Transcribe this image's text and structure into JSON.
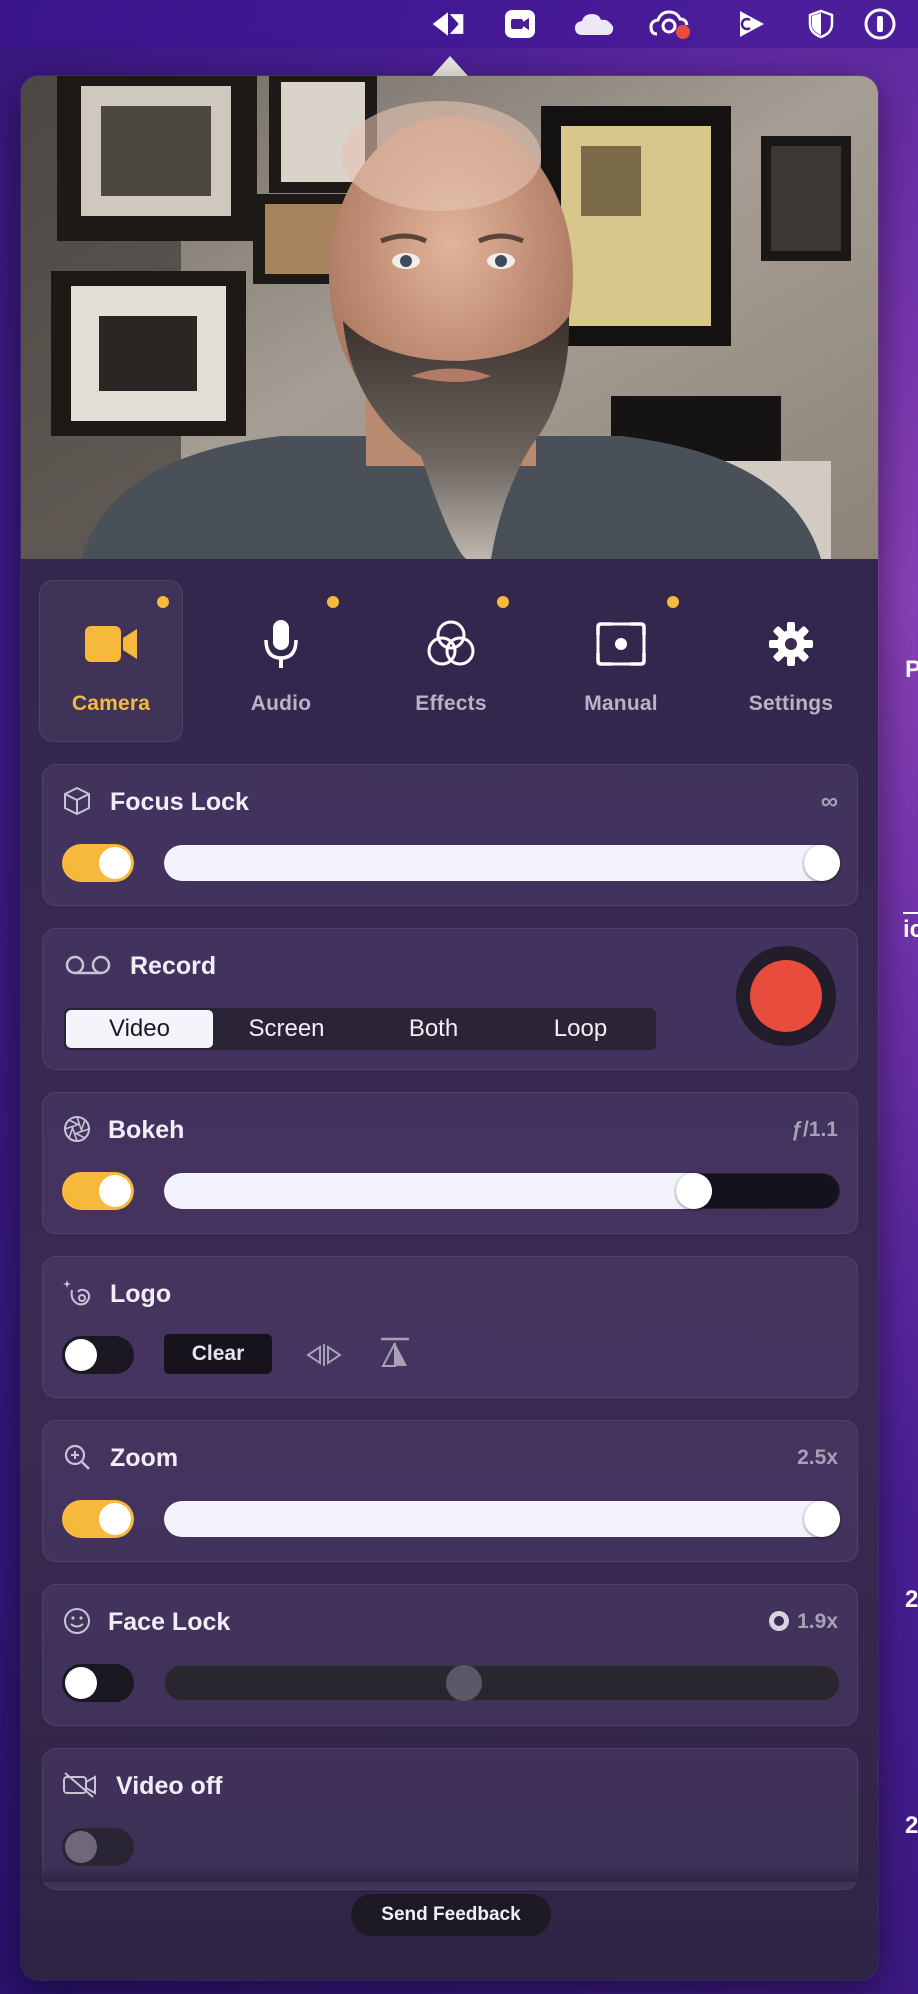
{
  "menubar": {
    "icons": [
      "camo-icon",
      "video-camera-icon",
      "cloud-icon",
      "creative-cloud-icon",
      "play-icon",
      "shield-icon",
      "password-manager-icon"
    ]
  },
  "side_text": {
    "top": "P",
    "middle": "ic",
    "bottom1": "2",
    "bottom2": "2"
  },
  "tabs": [
    {
      "label": "Camera",
      "icon": "video-camera-icon",
      "active": true,
      "dot": true
    },
    {
      "label": "Audio",
      "icon": "microphone-icon",
      "active": false,
      "dot": true
    },
    {
      "label": "Effects",
      "icon": "effects-circles-icon",
      "active": false,
      "dot": true
    },
    {
      "label": "Manual",
      "icon": "manual-frame-icon",
      "active": false,
      "dot": true
    },
    {
      "label": "Settings",
      "icon": "gear-icon",
      "active": false,
      "dot": false
    }
  ],
  "focus_lock": {
    "title": "Focus Lock",
    "value": "∞",
    "enabled": true,
    "level": 1.0
  },
  "record": {
    "title": "Record",
    "modes": [
      "Video",
      "Screen",
      "Both",
      "Loop"
    ],
    "selected": "Video"
  },
  "bokeh": {
    "title": "Bokeh",
    "value": "ƒ/1.1",
    "enabled": true,
    "level": 0.8
  },
  "logo": {
    "title": "Logo",
    "enabled": false,
    "clear_label": "Clear"
  },
  "zoom": {
    "title": "Zoom",
    "value": "2.5x",
    "enabled": true,
    "level": 1.0
  },
  "face_lock": {
    "title": "Face Lock",
    "value": "1.9x",
    "enabled": false,
    "level": 0.44
  },
  "video_off": {
    "title": "Video off",
    "enabled": false
  },
  "footer": {
    "feedback_label": "Send Feedback"
  },
  "colors": {
    "accent": "#f6b93b",
    "record": "#e74c3c",
    "background": "#2f2448"
  }
}
